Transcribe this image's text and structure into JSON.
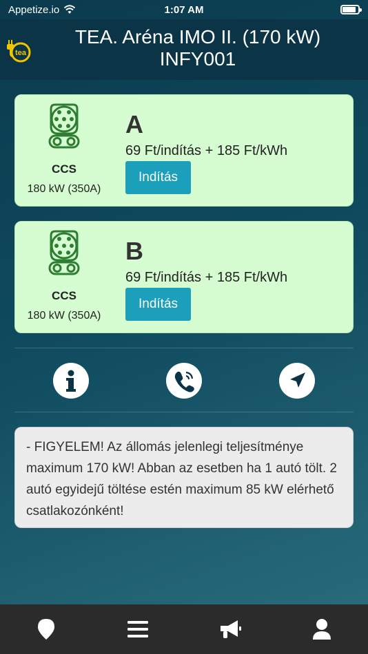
{
  "status_bar": {
    "carrier": "Appetize.io",
    "time": "1:07 AM",
    "battery_level": 0.85
  },
  "header": {
    "title_line1": "TEA. Aréna IMO II. (170 kW)",
    "title_line2": "INFY001",
    "logo_text": "tea"
  },
  "connectors": [
    {
      "letter": "A",
      "type": "CCS",
      "power": "180 kW (350A)",
      "price": "69 Ft/indítás + 185 Ft/kWh",
      "start_label": "Indítás"
    },
    {
      "letter": "B",
      "type": "CCS",
      "power": "180 kW (350A)",
      "price": "69 Ft/indítás + 185 Ft/kWh",
      "start_label": "Indítás"
    }
  ],
  "actions": {
    "info_icon": "info-icon",
    "phone_icon": "phone-icon",
    "navigate_icon": "navigation-arrow-icon"
  },
  "notice": {
    "text": "- FIGYELEM! Az állomás jelenlegi teljesítménye maximum 170 kW! Abban az esetben ha 1 autó tölt. 2 autó egyidejű töltése estén maximum 85 kW elérhető csatlakozónként!"
  },
  "tabbar": {
    "items": [
      "map-pin-icon",
      "menu-icon",
      "megaphone-icon",
      "user-icon"
    ]
  },
  "colors": {
    "accent": "#1b9fba",
    "card_green": "#d6fcd2",
    "connector_green": "#2e7d32",
    "header_bg": "#0b3446",
    "tabbar_bg": "#2b2b2b"
  }
}
